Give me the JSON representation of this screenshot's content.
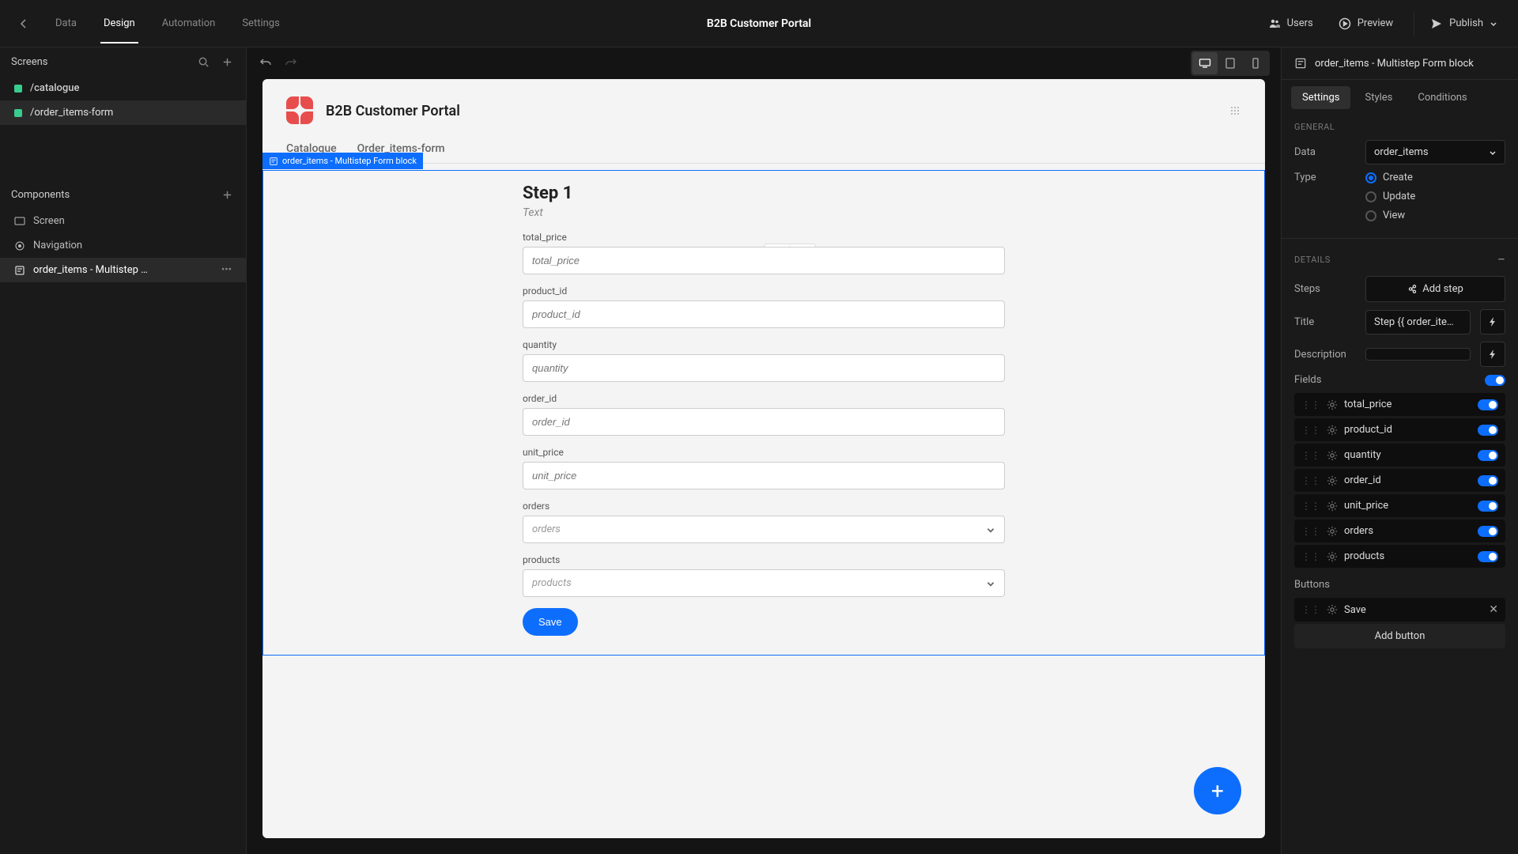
{
  "header": {
    "tabs": [
      "Data",
      "Design",
      "Automation",
      "Settings"
    ],
    "active_tab": 1,
    "title": "B2B Customer Portal",
    "actions": {
      "users": "Users",
      "preview": "Preview",
      "publish": "Publish"
    }
  },
  "sidebar": {
    "screens_title": "Screens",
    "screens": [
      {
        "label": "/catalogue",
        "selected": false
      },
      {
        "label": "/order_items-form",
        "selected": true
      }
    ],
    "components_title": "Components",
    "components": [
      {
        "label": "Screen",
        "icon": "screen",
        "selected": false
      },
      {
        "label": "Navigation",
        "icon": "nav",
        "selected": false
      },
      {
        "label": "order_items - Multistep For...",
        "icon": "form",
        "selected": true,
        "has_more": true
      }
    ]
  },
  "canvas": {
    "app_title": "B2B Customer Portal",
    "nav_items": [
      "Catalogue",
      "Order_items-form"
    ],
    "selected_block_label": "order_items - Multistep Form block",
    "step_title": "Step 1",
    "step_subtitle": "Text",
    "fields": [
      {
        "label": "total_price",
        "placeholder": "total_price",
        "type": "text"
      },
      {
        "label": "product_id",
        "placeholder": "product_id",
        "type": "text"
      },
      {
        "label": "quantity",
        "placeholder": "quantity",
        "type": "text"
      },
      {
        "label": "order_id",
        "placeholder": "order_id",
        "type": "text"
      },
      {
        "label": "unit_price",
        "placeholder": "unit_price",
        "type": "text"
      },
      {
        "label": "orders",
        "placeholder": "orders",
        "type": "select"
      },
      {
        "label": "products",
        "placeholder": "products",
        "type": "select"
      }
    ],
    "save_label": "Save"
  },
  "right": {
    "header_label": "order_items - Multistep Form block",
    "tabs": [
      "Settings",
      "Styles",
      "Conditions"
    ],
    "active_tab": 0,
    "general_title": "GENERAL",
    "data_label": "Data",
    "data_value": "order_items",
    "type_label": "Type",
    "type_options": [
      "Create",
      "Update",
      "View"
    ],
    "type_selected": 0,
    "details_title": "DETAILS",
    "steps_label": "Steps",
    "add_step_label": "Add step",
    "title_label": "Title",
    "title_value": "Step {{ order_item…",
    "description_label": "Description",
    "fields_label": "Fields",
    "field_items": [
      "total_price",
      "product_id",
      "quantity",
      "order_id",
      "unit_price",
      "orders",
      "products"
    ],
    "buttons_label": "Buttons",
    "button_items": [
      "Save"
    ],
    "add_button_label": "Add button"
  }
}
